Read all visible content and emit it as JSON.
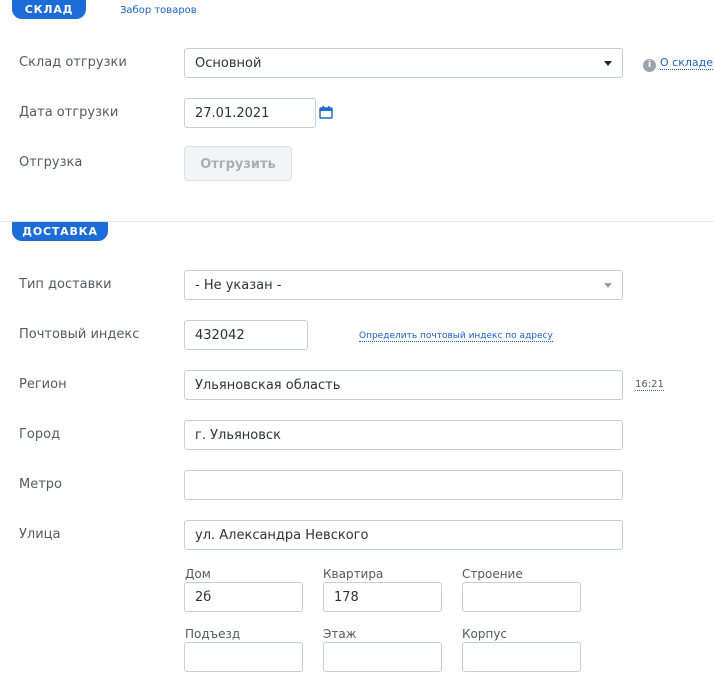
{
  "warehouse_section": {
    "tab_label": "СКЛАД",
    "pickup_link": "Забор товаров",
    "ship_warehouse_label": "Склад отгрузки",
    "ship_warehouse_value": "Основной",
    "about_warehouse_link": "О складе",
    "ship_date_label": "Дата отгрузки",
    "ship_date_value": "27.01.2021",
    "shipment_label": "Отгрузка",
    "ship_button": "Отгрузить"
  },
  "delivery_section": {
    "tab_label": "ДОСТАВКА",
    "delivery_type_label": "Тип доставки",
    "delivery_type_value": "- Не указан -",
    "postal_code_label": "Почтовый индекс",
    "postal_code_value": "432042",
    "detect_postal_link": "Определить почтовый индекс по адресу",
    "region_label": "Регион",
    "region_value": "Ульяновская область",
    "region_time": "16:21",
    "city_label": "Город",
    "city_value": "г. Ульяновск",
    "metro_label": "Метро",
    "metro_value": "",
    "street_label": "Улица",
    "street_value": "ул. Александра Невского",
    "house_label": "Дом",
    "house_value": "2б",
    "apartment_label": "Квартира",
    "apartment_value": "178",
    "building_label": "Строение",
    "building_value": "",
    "entrance_label": "Подъезд",
    "entrance_value": "",
    "floor_label": "Этаж",
    "floor_value": "",
    "block_label": "Корпус",
    "block_value": ""
  },
  "colors": {
    "accent": "#1c6bd6",
    "link": "#1c5fc2",
    "border": "#c9ced4"
  }
}
